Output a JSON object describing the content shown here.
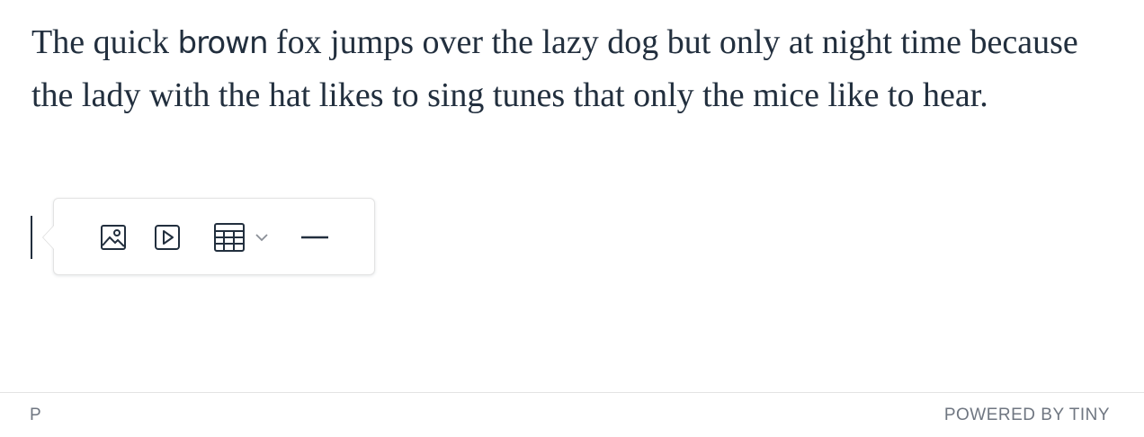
{
  "content": {
    "paragraph_before": "The quick ",
    "bold_word": "brown",
    "paragraph_after": " fox jumps over the lazy dog but only at night time because the lady with the hat likes to sing tunes that only the mice like to hear."
  },
  "quickbar": {
    "buttons": [
      {
        "name": "insert-image",
        "icon": "image-icon"
      },
      {
        "name": "insert-media",
        "icon": "media-icon"
      },
      {
        "name": "insert-table",
        "icon": "table-icon",
        "has_dropdown": true
      },
      {
        "name": "insert-horizontal-rule",
        "icon": "horizontal-rule-icon"
      }
    ]
  },
  "statusbar": {
    "path": "P",
    "branding": "POWERED BY TINY"
  },
  "colors": {
    "text": "#222f3e",
    "icon": "#222f3e",
    "status_text": "#6f7681",
    "border": "#e3e3e3"
  }
}
